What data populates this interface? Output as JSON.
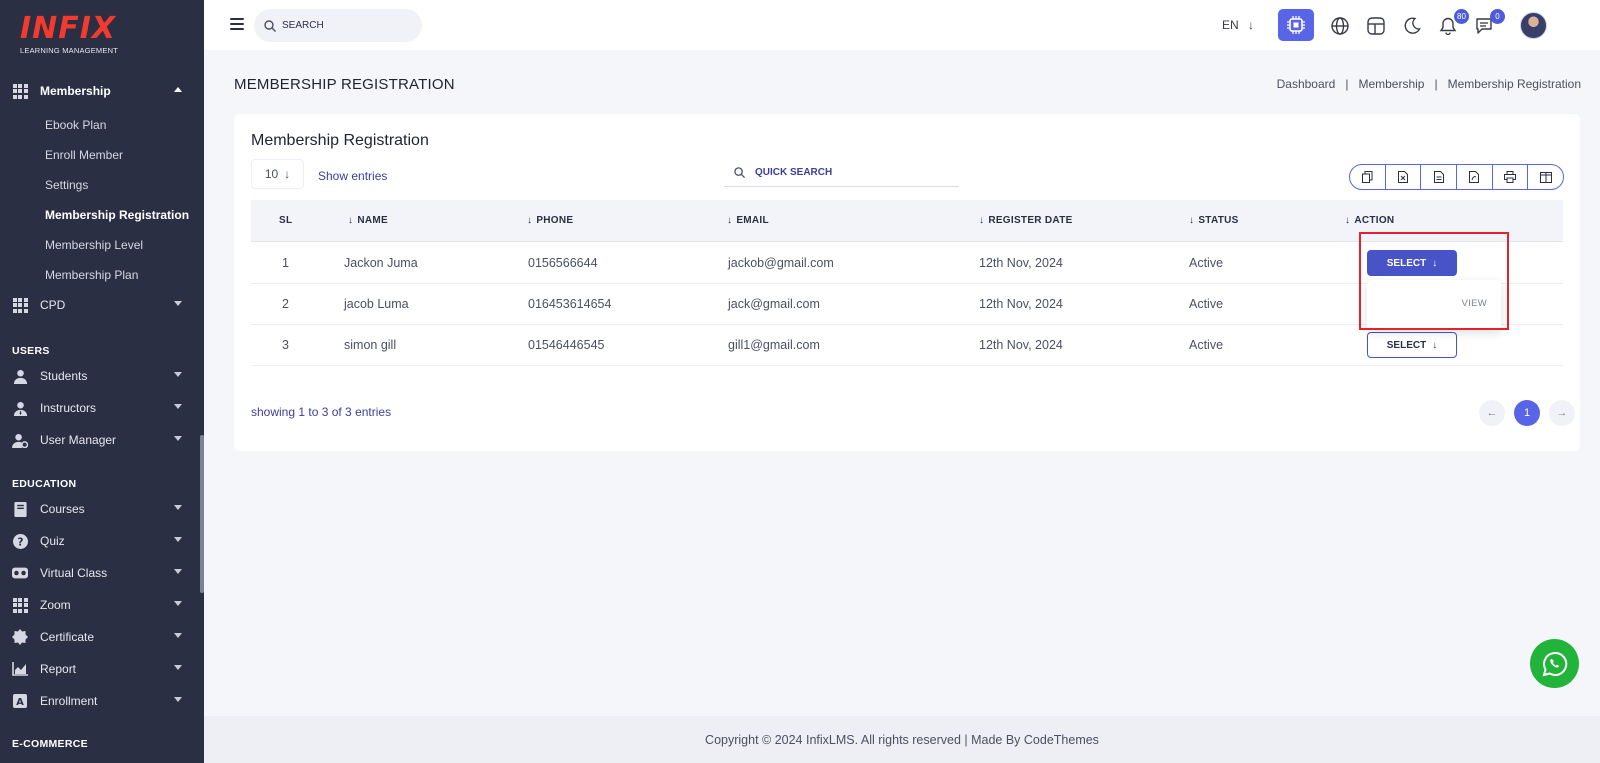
{
  "brand": {
    "name": "INFIX",
    "tagline": "LEARNING MANAGEMENT"
  },
  "sidebar": {
    "membership": {
      "label": "Membership",
      "sub_items": [
        "Ebook Plan",
        "Enroll Member",
        "Settings",
        "Membership Registration",
        "Membership Level",
        "Membership Plan"
      ],
      "active": "Membership Registration"
    },
    "cpd": "CPD",
    "sections": {
      "users": "USERS",
      "education": "EDUCATION",
      "ecommerce": "E-COMMERCE"
    },
    "users_items": [
      "Students",
      "Instructors",
      "User Manager"
    ],
    "education_items": [
      "Courses",
      "Quiz",
      "Virtual Class",
      "Zoom",
      "Certificate",
      "Report",
      "Enrollment"
    ]
  },
  "header": {
    "search_placeholder": "SEARCH",
    "lang": "EN",
    "notifications_count": "80",
    "messages_count": "0"
  },
  "page": {
    "title": "MEMBERSHIP REGISTRATION",
    "breadcrumb": [
      "Dashboard",
      "Membership",
      "Membership Registration"
    ],
    "breadcrumb_sep": "|"
  },
  "card": {
    "title": "Membership Registration",
    "entries_value": "10",
    "entries_label": "Show entries",
    "quick_search_placeholder": "QUICK SEARCH",
    "columns": [
      "SL",
      "NAME",
      "PHONE",
      "EMAIL",
      "REGISTER DATE",
      "STATUS",
      "ACTION"
    ],
    "rows": [
      {
        "sl": "1",
        "name": "Jackon Juma",
        "phone": "0156566644",
        "email": "jackob@gmail.com",
        "date": "12th Nov, 2024",
        "status": "Active",
        "action": "SELECT"
      },
      {
        "sl": "2",
        "name": "jacob Luma",
        "phone": "016453614654",
        "email": "jack@gmail.com",
        "date": "12th Nov, 2024",
        "status": "Active",
        "action": "SELECT"
      },
      {
        "sl": "3",
        "name": "simon gill",
        "phone": "01546446545",
        "email": "gill1@gmail.com",
        "date": "12th Nov, 2024",
        "status": "Active",
        "action": "SELECT"
      }
    ],
    "dropdown_item": "VIEW",
    "showing": "showing 1 to 3 of 3 entries",
    "current_page": "1"
  },
  "footer": "Copyright © 2024 InfixLMS. All rights reserved | Made By CodeThemes",
  "colors": {
    "sidebar_bg": "#2a2f43",
    "accent": "#5865e6",
    "brand_red": "#f23a2f",
    "whatsapp": "#22b33b",
    "highlight": "#e3222a"
  }
}
